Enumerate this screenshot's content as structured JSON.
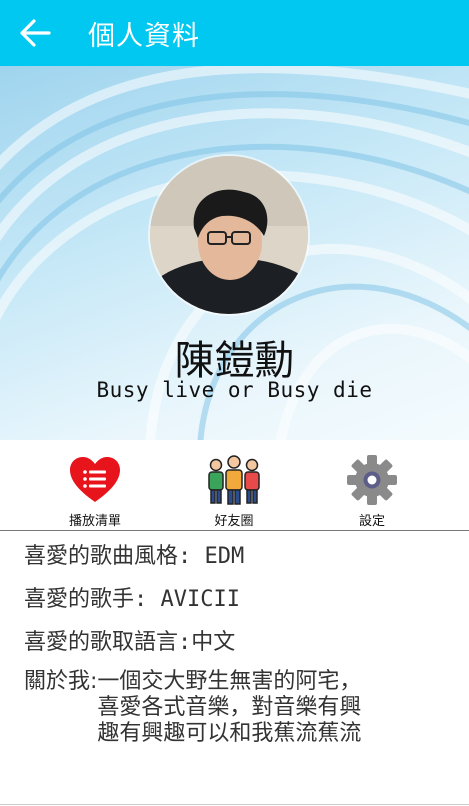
{
  "appbar": {
    "title": "個人資料"
  },
  "profile": {
    "name": "陳鎧勳",
    "motto": "Busy live or Busy die"
  },
  "actions": [
    {
      "label": "播放清單",
      "icon": "playlist-heart-icon"
    },
    {
      "label": "好友圈",
      "icon": "friends-group-icon"
    },
    {
      "label": "設定",
      "icon": "gear-icon"
    }
  ],
  "info": {
    "genre": "喜愛的歌曲風格: EDM",
    "artist": "喜愛的歌手: AVICII",
    "language": "喜愛的歌取語言:中文",
    "about_label": "關於我:",
    "about_text": "一個交大野生無害的阿宅，喜愛各式音樂，對音樂有興趣有興趣可以和我蕉流蕉流"
  },
  "colors": {
    "appbar": "#00c8f0",
    "heart": "#e8141c",
    "gear": "#8a8a8a"
  }
}
